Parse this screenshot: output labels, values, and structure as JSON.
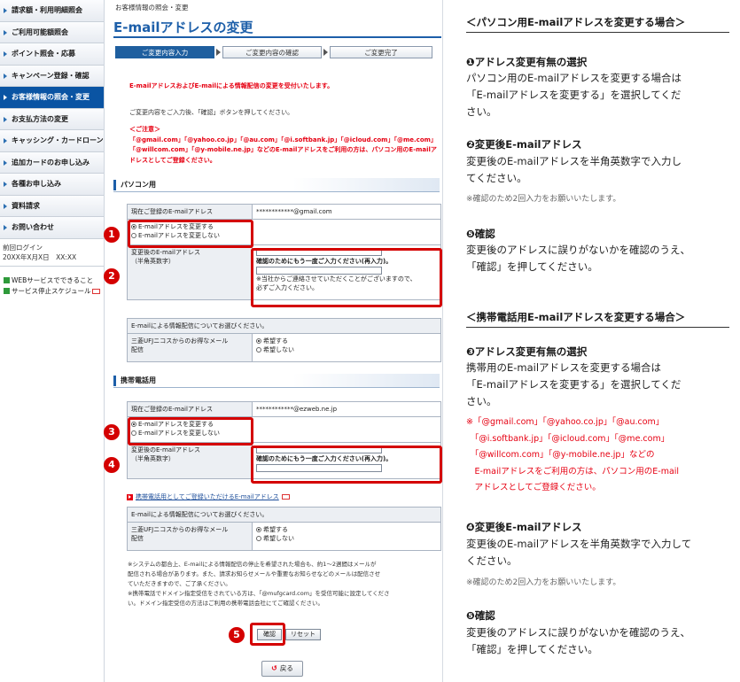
{
  "sidebar": {
    "items": [
      {
        "label": "請求額・利用明細照会",
        "active": false
      },
      {
        "label": "ご利用可能額照会",
        "active": false
      },
      {
        "label": "ポイント照会・応募",
        "active": false
      },
      {
        "label": "キャンペーン登録・確認",
        "active": false
      },
      {
        "label": "お客様情報の照会・変更",
        "active": true
      },
      {
        "label": "お支払方法の変更",
        "active": false
      },
      {
        "label": "キャッシング・カードローン",
        "active": false
      },
      {
        "label": "追加カードのお申し込み",
        "active": false
      },
      {
        "label": "各種お申し込み",
        "active": false
      },
      {
        "label": "資料請求",
        "active": false
      },
      {
        "label": "お問い合わせ",
        "active": false
      }
    ],
    "login_label": "前回ログイン",
    "login_time": "20XX年X月X日　XX:XX",
    "link_web": "WEBサービスでできること",
    "link_stop": "サービス停止スケジュール"
  },
  "main": {
    "breadcrumb": "お客様情報の照会・変更",
    "title": "E-mailアドレスの変更",
    "steps": [
      "ご変更内容入力",
      "ご変更内容の確認",
      "ご変更完了"
    ],
    "intro_red": "E-mailアドレスおよびE-mailによる情報配信の変更を受付いたします。",
    "intro_black": "ご変更内容をご入力後、「確認」ボタンを押してください。",
    "caution_title": "＜ご注意＞",
    "caution_lines": [
      "「@gmail.com」「@yahoo.co.jp」「@au.com」「@i.softbank.jp」「@icloud.com」「@me.com」",
      "「@willcom.com」「@y-mobile.ne.jp」などのE-mailアドレスをご利用の方は、パソコン用のE-mailア",
      "ドレスとしてご登録ください。"
    ],
    "pc": {
      "heading": "パソコン用",
      "current_label": "現在ご登録のE-mailアドレス",
      "current_value": "************@gmail.com",
      "radio_change": "E-mailアドレスを変更する",
      "radio_keep": "E-mailアドレスを変更しない",
      "new_label": "変更後のE-mailアドレス",
      "new_sublabel": "（半角英数字）",
      "confirm_note": "確認のためにもう一度ご入力ください(再入力)。",
      "contact_note_1": "※当社からご連絡させていただくことがございますので、",
      "contact_note_2": "必ずご入力ください。",
      "info_header": "E-mailによる情報配信についてお選びください。",
      "info_label_1": "三菱UFJニコスからのお得なメール",
      "info_label_2": "配信",
      "opt_yes": "希望する",
      "opt_no": "希望しない"
    },
    "mobile": {
      "heading": "携帯電話用",
      "current_label": "現在ご登録のE-mailアドレス",
      "current_value": "************@ezweb.ne.jp",
      "radio_change": "E-mailアドレスを変更する",
      "radio_keep": "E-mailアドレスを変更しない",
      "new_label": "変更後のE-mailアドレス",
      "new_sublabel": "（半角英数字）",
      "confirm_note": "確認のためにもう一度ご入力ください(再入力)。",
      "link": "携帯電話用としてご登録いただけるE-mailアドレス",
      "info_header": "E-mailによる情報配信についてお選びください。",
      "info_label_1": "三菱UFJニコスからのお得なメール",
      "info_label_2": "配信",
      "opt_yes": "希望する",
      "opt_no": "希望しない"
    },
    "notes": [
      "※システムの都合上、E-mailによる情報配信の停止を希望された場合も、約1～2週間はメールが",
      "配信される場合があります。また、請求お知らせメールや重要なお知らせなどのメールは配信させ",
      "ていただきますので、ご了承ください。",
      "※携帯電話でドメイン指定受信をされている方は、「@mufgcard.com」を受信可能に設定してくださ",
      "い。ドメイン指定受信の方法はご利用の携帯電話会社にてご確認ください。"
    ],
    "confirm_button": "確認",
    "reset_button": "リセット",
    "back_button": "戻る"
  },
  "badges": [
    "1",
    "2",
    "3",
    "4",
    "5"
  ],
  "explain": {
    "pc_heading": "＜パソコン用E-mailアドレスを変更する場合＞",
    "pc_1_title": "❶アドレス変更有無の選択",
    "pc_1_lines": [
      "パソコン用のE-mailアドレスを変更する場合は",
      "「E-mailアドレスを変更する」を選択してくだ",
      "さい。"
    ],
    "pc_2_title": "❷変更後E-mailアドレス",
    "pc_2_lines": [
      "変更後のE-mailアドレスを半角英数字で入力し",
      "てください。"
    ],
    "pc_2_note": "※確認のため2回入力をお願いいたします。",
    "pc_5_title": "❺確認",
    "pc_5_lines": [
      "変更後のアドレスに誤りがないかを確認のうえ、",
      "「確認」を押してください。"
    ],
    "mob_heading": "＜携帯電話用E-mailアドレスを変更する場合＞",
    "mob_3_title": "❸アドレス変更有無の選択",
    "mob_3_lines": [
      "携帯用のE-mailアドレスを変更する場合は",
      "「E-mailアドレスを変更する」を選択してくだ",
      "さい。"
    ],
    "mob_3_red": [
      "※「@gmail.com」「@yahoo.co.jp」「@au.com」",
      "　「@i.softbank.jp」「@icloud.com」「@me.com」",
      "　「@willcom.com」「@y-mobile.ne.jp」などの",
      "　E-mailアドレスをご利用の方は、パソコン用のE-mail",
      "　アドレスとしてご登録ください。"
    ],
    "mob_4_title": "❹変更後E-mailアドレス",
    "mob_4_lines": [
      "変更後のE-mailアドレスを半角英数字で入力して",
      "ください。"
    ],
    "mob_4_note": "※確認のため2回入力をお願いいたします。",
    "mob_5_title": "❺確認",
    "mob_5_lines": [
      "変更後のアドレスに誤りがないかを確認のうえ、",
      "「確認」を押してください。"
    ]
  },
  "colors": {
    "brand": "#0a54a3",
    "title": "#1d5fa9",
    "alert": "#e60012",
    "annotation": "#d40000"
  }
}
